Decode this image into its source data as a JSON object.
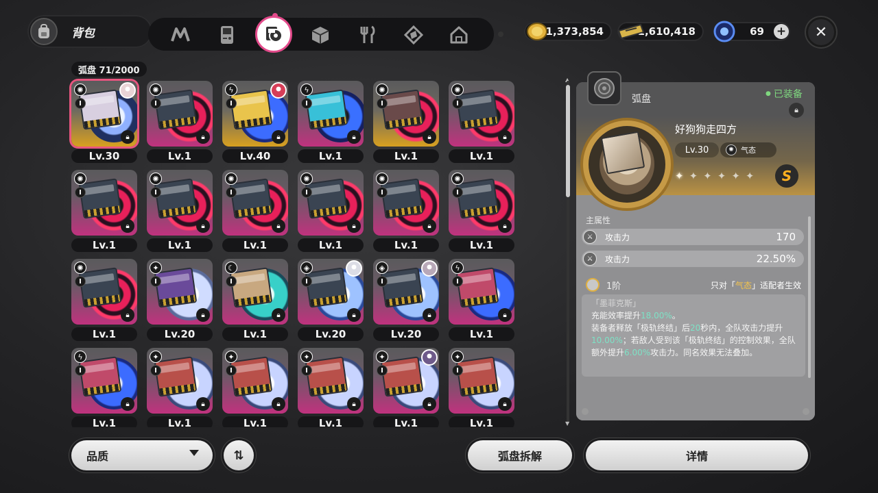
{
  "header": {
    "title": "背包",
    "tabs": [
      {
        "name": "tab-agents",
        "icon": "n-logo-icon"
      },
      {
        "name": "tab-gadgets",
        "icon": "gameboy-icon"
      },
      {
        "name": "tab-drive-discs",
        "icon": "drive-disc-icon",
        "active": true
      },
      {
        "name": "tab-materials",
        "icon": "cube-icon"
      },
      {
        "name": "tab-food",
        "icon": "fork-knife-icon"
      },
      {
        "name": "tab-special",
        "icon": "diamond-box-icon"
      },
      {
        "name": "tab-home",
        "icon": "house-icon"
      }
    ]
  },
  "currencies": [
    {
      "name": "dennies",
      "value": "1,373,854",
      "color": "#e3b23c"
    },
    {
      "name": "ticket",
      "value": "1,610,418",
      "color": "#d9b54a"
    },
    {
      "name": "charge",
      "value": "69",
      "color": "#5a8cf2"
    }
  ],
  "inventory": {
    "counter": "弧盘  71/2000",
    "items": [
      {
        "level": "Lv.30",
        "theme": "gold",
        "attr": "✺",
        "avatar": "#e9d3d6",
        "selected": true
      },
      {
        "level": "Lv.1",
        "theme": "pink",
        "attr": "✺"
      },
      {
        "level": "Lv.40",
        "theme": "gold-blue",
        "attr": "ϟ",
        "avatar": "#d63e58"
      },
      {
        "level": "Lv.1",
        "theme": "cyan",
        "attr": "ϟ"
      },
      {
        "level": "Lv.1",
        "theme": "gold-red",
        "attr": "✺"
      },
      {
        "level": "Lv.1",
        "theme": "pink",
        "attr": "✺"
      },
      {
        "level": "Lv.1",
        "theme": "pink",
        "attr": "✺"
      },
      {
        "level": "Lv.1",
        "theme": "pink",
        "attr": "✺"
      },
      {
        "level": "Lv.1",
        "theme": "pink",
        "attr": "✺"
      },
      {
        "level": "Lv.1",
        "theme": "pink",
        "attr": "✺"
      },
      {
        "level": "Lv.1",
        "theme": "pink",
        "attr": "✺"
      },
      {
        "level": "Lv.1",
        "theme": "pink",
        "attr": "✺"
      },
      {
        "level": "Lv.1",
        "theme": "pink",
        "attr": "✺"
      },
      {
        "level": "Lv.20",
        "theme": "white",
        "attr": "✦"
      },
      {
        "level": "Lv.1",
        "theme": "teal",
        "attr": "☾"
      },
      {
        "level": "Lv.20",
        "theme": "white-blue",
        "attr": "◈",
        "avatar": "#dcdde6"
      },
      {
        "level": "Lv.20",
        "theme": "white-blue",
        "attr": "◈",
        "avatar": "#b8a8b8"
      },
      {
        "level": "Lv.1",
        "theme": "blue",
        "attr": "ϟ"
      },
      {
        "level": "Lv.1",
        "theme": "blue",
        "attr": "ϟ"
      },
      {
        "level": "Lv.1",
        "theme": "white-red",
        "attr": "✦"
      },
      {
        "level": "Lv.1",
        "theme": "white-red",
        "attr": "✦"
      },
      {
        "level": "Lv.1",
        "theme": "white-red",
        "attr": "✦"
      },
      {
        "level": "Lv.1",
        "theme": "white-red",
        "attr": "✦",
        "avatar": "#6e5a8a"
      },
      {
        "level": "Lv.1",
        "theme": "white-red",
        "attr": "✦"
      }
    ]
  },
  "detail": {
    "category": "弧盘",
    "equipped": "已装备",
    "name": "好狗狗走四方",
    "level": "Lv.30",
    "attribute": "气态",
    "rank": "S",
    "stars_total": 6,
    "stars_filled": 1,
    "main_stats_title": "主属性",
    "stats": [
      {
        "label": "攻击力",
        "value": "170"
      },
      {
        "label": "攻击力",
        "value": "22.50%"
      }
    ],
    "tier": "1阶",
    "restriction_prefix": "只对「",
    "restriction_attr": "气态",
    "restriction_suffix": "」适配者生效",
    "effect_name": "「墨菲克斯」",
    "effect_p1_a": "充能效率提升",
    "effect_p1_b": "18.00%",
    "effect_p1_c": "。",
    "effect_p2_a": "装备者释放「极轨终结」后",
    "effect_p2_b": "20",
    "effect_p2_c": "秒内，全队攻击力提升",
    "effect_p2_d": "10.00%",
    "effect_p2_e": "；若敌人受到该「极轨终结」的控制效果，全队额外提升",
    "effect_p2_f": "6.00%",
    "effect_p2_g": "攻击力。同名效果无法叠加。"
  },
  "buttons": {
    "quality": "品质",
    "sort": "⇅",
    "dismantle": "弧盘拆解",
    "details": "详情"
  }
}
